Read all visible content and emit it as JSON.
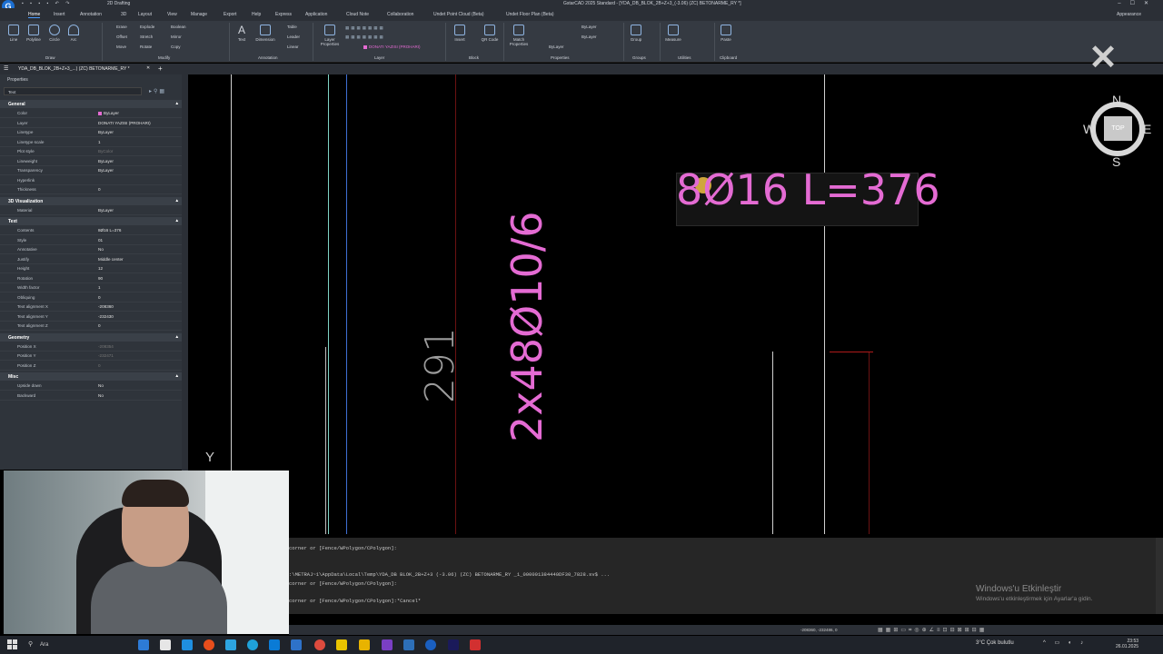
{
  "window": {
    "title": "GstarCAD 2025 Standard - [YDA_DB_BLOK_2B+Z+3_(-3.06) (ZC) BETONARME_RY *]",
    "workspace": "2D Drafting",
    "appearance": "Appearance"
  },
  "menu_tabs": [
    "Home",
    "Insert",
    "Annotation",
    "3D",
    "Layout",
    "View",
    "Manage",
    "Export",
    "Help",
    "Express",
    "Application",
    "Cloud Note",
    "Collaboration",
    "Undet Point Cloud (Beta)",
    "Undet Floor Plan (Beta)"
  ],
  "ribbon": {
    "draw": {
      "label": "Draw",
      "tools": [
        "Line",
        "Polyline",
        "Circle",
        "Arc"
      ]
    },
    "modify": {
      "label": "Modify",
      "tools": [
        "Erase",
        "Explode",
        "Boolean",
        "Offset",
        "Stretch",
        "Mirror",
        "Move",
        "Rotate",
        "Copy"
      ]
    },
    "annotation": {
      "label": "Annotation",
      "tools": [
        "Text",
        "Dimension",
        "Table",
        "Leader",
        "Linear"
      ]
    },
    "layer": {
      "label": "Layer",
      "tool": "Layer Properties",
      "current": "DONATI YAZISI (PROHARI)"
    },
    "block": {
      "label": "Block",
      "tools": [
        "Insert",
        "QR Code"
      ]
    },
    "properties": {
      "label": "Properties",
      "tool": "Match Properties",
      "values": [
        "ByLayer",
        "ByLayer",
        "ByLayer"
      ]
    },
    "groups": {
      "label": "Groups",
      "tool": "Group"
    },
    "utilities": {
      "label": "Utilities",
      "tool": "Measure"
    },
    "clipboard": {
      "label": "Clipboard",
      "tool": "Paste"
    }
  },
  "document_tab": {
    "label": "YDA_DB_BLOK_2B+Z+3_...) (ZC) BETONARME_RY *"
  },
  "properties_panel": {
    "header": "Properties",
    "selection": "Text",
    "sections": {
      "general": {
        "title": "General",
        "rows": [
          {
            "k": "Color",
            "v": "ByLayer"
          },
          {
            "k": "Layer",
            "v": "DONATI YAZISI (PROHARI)"
          },
          {
            "k": "Linetype",
            "v": "ByLayer"
          },
          {
            "k": "Linetype scale",
            "v": "1"
          },
          {
            "k": "Plot style",
            "v": "ByColor"
          },
          {
            "k": "Lineweight",
            "v": "ByLayer"
          },
          {
            "k": "Transparency",
            "v": "ByLayer"
          },
          {
            "k": "Hyperlink",
            "v": ""
          },
          {
            "k": "Thickness",
            "v": "0"
          }
        ]
      },
      "viz3d": {
        "title": "3D Visualization",
        "rows": [
          {
            "k": "Material",
            "v": "ByLayer"
          }
        ]
      },
      "text": {
        "title": "Text",
        "rows": [
          {
            "k": "Contents",
            "v": "8Ø16 L=376"
          },
          {
            "k": "Style",
            "v": "01"
          },
          {
            "k": "Annotative",
            "v": "No"
          },
          {
            "k": "Justify",
            "v": "Middle center"
          },
          {
            "k": "Height",
            "v": "12"
          },
          {
            "k": "Rotation",
            "v": "90"
          },
          {
            "k": "Width factor",
            "v": "1"
          },
          {
            "k": "Obliquing",
            "v": "0"
          },
          {
            "k": "Text alignment X",
            "v": "-208360"
          },
          {
            "k": "Text alignment Y",
            "v": "-232430"
          },
          {
            "k": "Text alignment Z",
            "v": "0"
          }
        ]
      },
      "geometry": {
        "title": "Geometry",
        "rows": [
          {
            "k": "Position X",
            "v": "-208354"
          },
          {
            "k": "Position Y",
            "v": "-232471"
          },
          {
            "k": "Position Z",
            "v": "0"
          }
        ]
      },
      "misc": {
        "title": "Misc",
        "rows": [
          {
            "k": "Upside down",
            "v": "No"
          },
          {
            "k": "Backward",
            "v": "No"
          }
        ]
      }
    }
  },
  "canvas": {
    "note_text": "8Ø16 L=376",
    "vertical_note": "2x48Ø10/6",
    "vertical_dim": "291",
    "ucs_label": "Y",
    "colors": {
      "annotation": "#e46bd3",
      "background": "#000000"
    }
  },
  "viewcube": {
    "top": "TOP",
    "north": "N",
    "south": "S",
    "west": "W",
    "east": "E"
  },
  "command_line": {
    "lines": [
      "corner or [Fence/WPolygon/CPolygon]:",
      ":\\METRAJ~1\\AppData\\Local\\Temp\\YDA_DB  BLOK_2B+Z+3  (-3.06)  (ZC)  BETONARME_RY  _1_000001384440DF30_7828.sv$ ...",
      "corner or [Fence/WPolygon/CPolygon]:",
      "corner or [Fence/WPolygon/CPolygon]:*Cancel*"
    ]
  },
  "windows_activation": {
    "title": "Windows'u Etkinleştir",
    "subtitle": "Windows'u etkinleştirmek için Ayarlar'a gidin."
  },
  "status_bar": {
    "coords": "-208360, -232486, 0"
  },
  "taskbar": {
    "search": "Ara",
    "weather": "3°C  Çok bulutlu",
    "time": "23:53",
    "date": "26.01.2025"
  }
}
